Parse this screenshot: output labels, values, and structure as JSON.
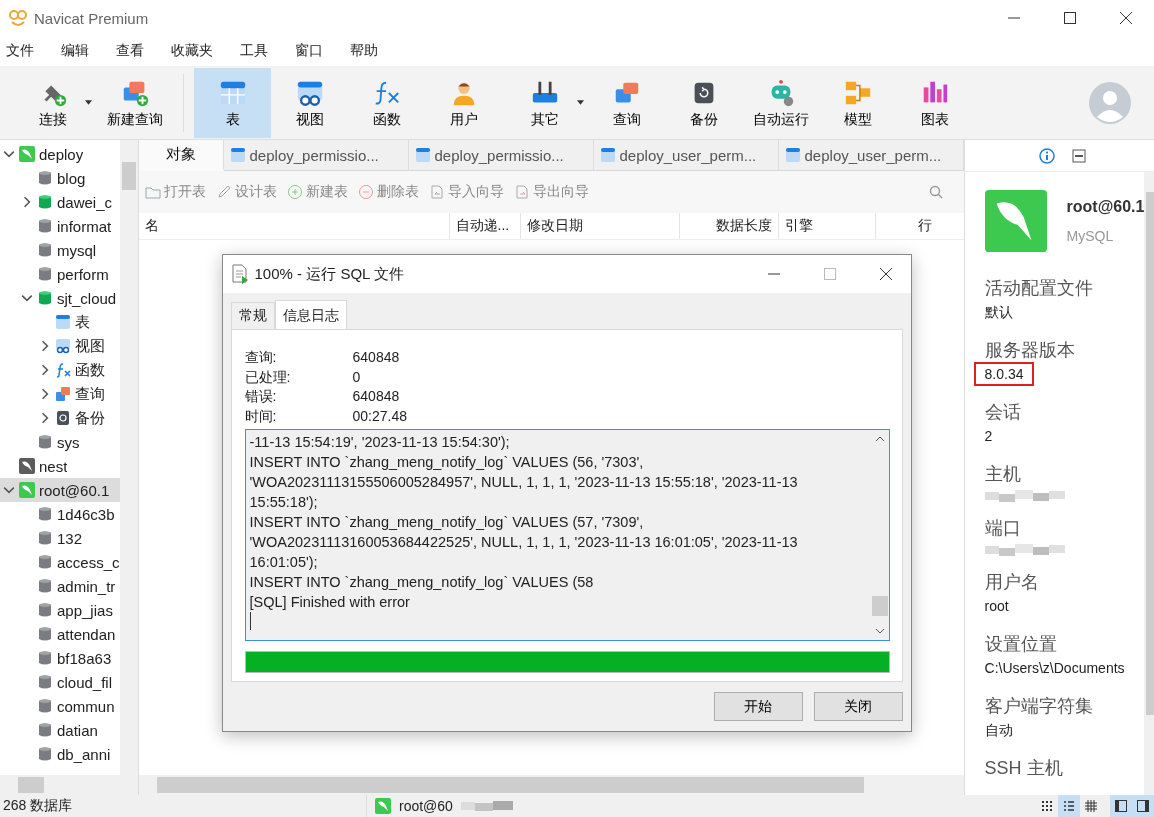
{
  "window": {
    "title": "Navicat Premium"
  },
  "menu": [
    "文件",
    "编辑",
    "查看",
    "收藏夹",
    "工具",
    "窗口",
    "帮助"
  ],
  "toolbar": [
    {
      "label": "连接",
      "dropdown": true,
      "selected": false
    },
    {
      "label": "新建查询",
      "dropdown": false,
      "selected": false
    },
    {
      "label": "表",
      "dropdown": false,
      "selected": true
    },
    {
      "label": "视图",
      "dropdown": false,
      "selected": false
    },
    {
      "label": "函数",
      "dropdown": false,
      "selected": false
    },
    {
      "label": "用户",
      "dropdown": false,
      "selected": false
    },
    {
      "label": "其它",
      "dropdown": true,
      "selected": false
    },
    {
      "label": "查询",
      "dropdown": false,
      "selected": false
    },
    {
      "label": "备份",
      "dropdown": false,
      "selected": false
    },
    {
      "label": "自动运行",
      "dropdown": false,
      "selected": false
    },
    {
      "label": "模型",
      "dropdown": false,
      "selected": false
    },
    {
      "label": "图表",
      "dropdown": false,
      "selected": false
    }
  ],
  "tree": [
    {
      "label": "deploy",
      "kind": "connection",
      "open": true,
      "expanded": true,
      "selected": false,
      "children": [
        {
          "label": "blog",
          "kind": "database",
          "open": false,
          "selected": false
        },
        {
          "label": "dawei_c",
          "kind": "database",
          "open": true,
          "expanded": false,
          "selected": false
        },
        {
          "label": "informat",
          "kind": "database",
          "open": false,
          "selected": false
        },
        {
          "label": "mysql",
          "kind": "database",
          "open": false,
          "selected": false
        },
        {
          "label": "perform",
          "kind": "database",
          "open": false,
          "selected": false
        },
        {
          "label": "sjt_cloud",
          "kind": "database",
          "open": true,
          "expanded": true,
          "selected": false,
          "children": [
            {
              "label": "表",
              "kind": "tables",
              "selected": false
            },
            {
              "label": "视图",
              "kind": "views",
              "expanded": false,
              "selected": false
            },
            {
              "label": "函数",
              "kind": "functions",
              "expanded": false,
              "selected": false
            },
            {
              "label": "查询",
              "kind": "queries",
              "expanded": false,
              "selected": false
            },
            {
              "label": "备份",
              "kind": "backups",
              "expanded": false,
              "selected": false
            }
          ]
        },
        {
          "label": "sys",
          "kind": "database",
          "open": false,
          "selected": false
        }
      ]
    },
    {
      "label": "nest",
      "kind": "connection",
      "open": false,
      "selected": false
    },
    {
      "label": "root@60.1",
      "kind": "connection",
      "open": true,
      "expanded": true,
      "selected": true,
      "children": [
        {
          "label": "1d46c3b",
          "kind": "database",
          "open": false,
          "selected": false
        },
        {
          "label": "132",
          "kind": "database",
          "open": false,
          "selected": false
        },
        {
          "label": "access_c",
          "kind": "database",
          "open": false,
          "selected": false
        },
        {
          "label": "admin_tr",
          "kind": "database",
          "open": false,
          "selected": false
        },
        {
          "label": "app_jias",
          "kind": "database",
          "open": false,
          "selected": false
        },
        {
          "label": "attendan",
          "kind": "database",
          "open": false,
          "selected": false
        },
        {
          "label": "bf18a63",
          "kind": "database",
          "open": false,
          "selected": false
        },
        {
          "label": "cloud_fil",
          "kind": "database",
          "open": false,
          "selected": false
        },
        {
          "label": "commun",
          "kind": "database",
          "open": false,
          "selected": false
        },
        {
          "label": "datian",
          "kind": "database",
          "open": false,
          "selected": false
        },
        {
          "label": "db_anni",
          "kind": "database",
          "open": false,
          "selected": false
        }
      ]
    }
  ],
  "object_tabs": [
    {
      "label": "对象",
      "kind": "objects",
      "selected": true
    },
    {
      "label": "deploy_permissio...",
      "kind": "table",
      "selected": false
    },
    {
      "label": "deploy_permissio...",
      "kind": "table",
      "selected": false
    },
    {
      "label": "deploy_user_perm...",
      "kind": "table",
      "selected": false
    },
    {
      "label": "deploy_user_perm...",
      "kind": "table",
      "selected": false
    }
  ],
  "object_toolbar": [
    {
      "label": "打开表",
      "disabled": true
    },
    {
      "label": "设计表",
      "disabled": true
    },
    {
      "label": "新建表",
      "disabled": true
    },
    {
      "label": "删除表",
      "disabled": true
    },
    {
      "label": "导入向导",
      "disabled": true
    },
    {
      "label": "导出向导",
      "disabled": true
    }
  ],
  "columns": [
    "名",
    "自动递...",
    "修改日期",
    "数据长度",
    "引擎",
    "行"
  ],
  "dialog": {
    "title": "100% - 运行 SQL 文件",
    "tabs": [
      {
        "label": "常规",
        "selected": false
      },
      {
        "label": "信息日志",
        "selected": true
      }
    ],
    "stats": [
      {
        "label": "查询:",
        "value": "640848"
      },
      {
        "label": "已处理:",
        "value": "0"
      },
      {
        "label": "错误:",
        "value": "640848"
      },
      {
        "label": "时间:",
        "value": "00:27.48"
      }
    ],
    "log": [
      "-11-13 15:54:19', '2023-11-13 15:54:30');",
      "INSERT INTO `zhang_meng_notify_log` VALUES (56, '7303',",
      "'WOA20231113155506005284957', NULL, 1, 1, 1, '2023-11-13 15:55:18', '2023-11-13",
      "15:55:18');",
      "INSERT INTO `zhang_meng_notify_log` VALUES (57, '7309',",
      "'WOA20231113160053684422525', NULL, 1, 1, 1, '2023-11-13 16:01:05', '2023-11-13",
      "16:01:05');",
      "INSERT INTO `zhang_meng_notify_log` VALUES (58",
      "[SQL] Finished with error"
    ],
    "progress": {
      "level": 1
    },
    "buttons": [
      "开始",
      "关闭"
    ]
  },
  "info_panel": {
    "tabs": [
      {
        "selected": true
      },
      {
        "selected": false
      }
    ],
    "name": "root@60.1",
    "type": "MySQL",
    "fields": [
      {
        "label": "活动配置文件",
        "kind": "text",
        "value": "默认"
      },
      {
        "label": "服务器版本",
        "kind": "text",
        "value": "8.0.34",
        "highlighted": true
      },
      {
        "label": "会话",
        "kind": "text",
        "value": "2"
      },
      {
        "label": "主机",
        "kind": "masked"
      },
      {
        "label": "端口",
        "kind": "masked"
      },
      {
        "label": "用户名",
        "kind": "text",
        "value": "root"
      },
      {
        "label": "设置位置",
        "kind": "text",
        "value": "C:\\Users\\z\\Documents"
      },
      {
        "label": "客户端字符集",
        "kind": "text",
        "value": "自动"
      },
      {
        "label": "SSH 主机",
        "kind": "text"
      }
    ]
  },
  "status_bar": {
    "count": "268 数据库",
    "connection": "root@60",
    "view_modes": [
      {
        "selected": false
      },
      {
        "selected": true
      },
      {
        "selected": false
      }
    ],
    "panes": [
      {
        "selected": true
      },
      {
        "selected": true
      }
    ]
  }
}
